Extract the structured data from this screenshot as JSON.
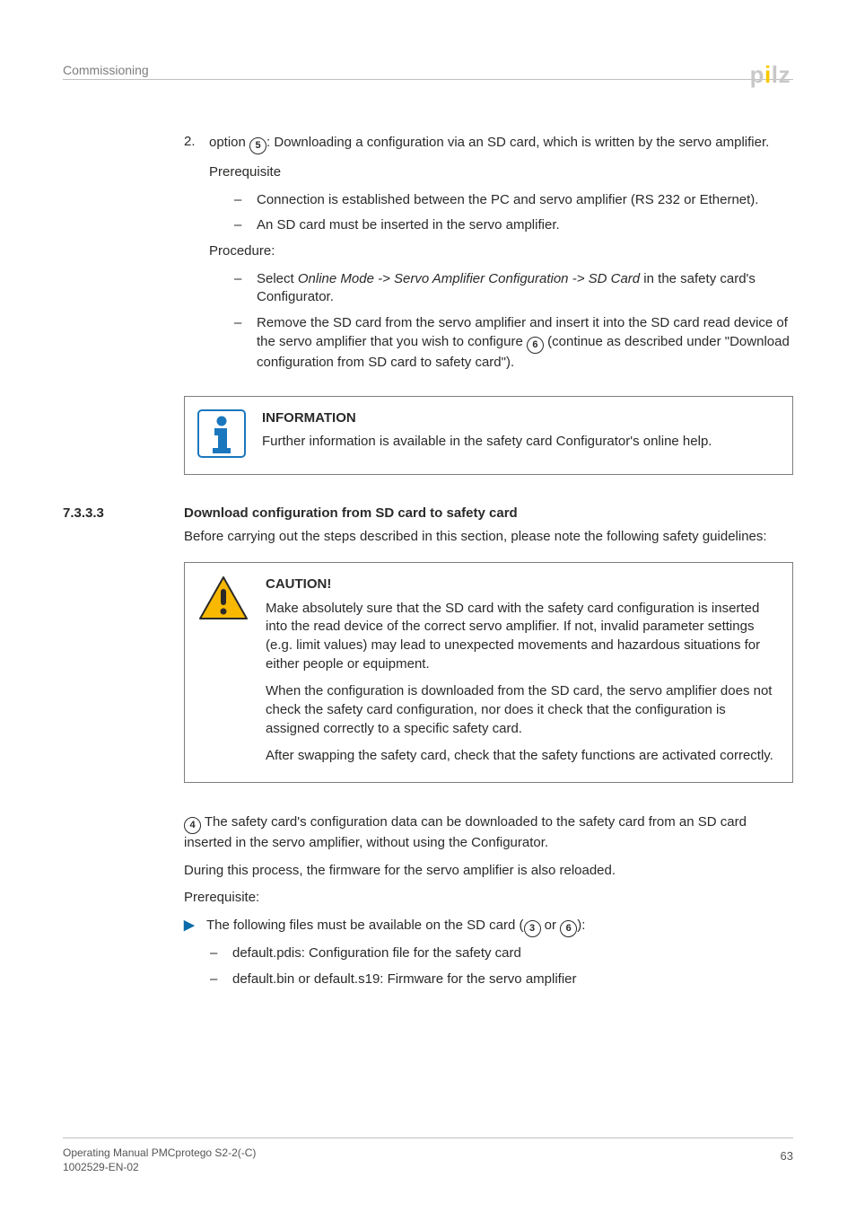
{
  "runningHead": "Commissioning",
  "logo": {
    "pre": "p",
    "dot": "i",
    "post": "lz"
  },
  "step2": {
    "num": "2.",
    "lead_a": "option ",
    "circ": "5",
    "lead_b": ": Downloading a configuration via an SD card, which is written by the servo amplifier.",
    "prereqLabel": "Prerequisite",
    "prereq1": "Connection is established between the PC and servo amplifier (RS 232 or Ethernet).",
    "prereq2": "An SD card must be inserted in the servo amplifier.",
    "procLabel": "Procedure:",
    "proc1_a": "Select ",
    "proc1_i": "Online Mode -> Servo Amplifier Configuration -> SD Card",
    "proc1_b": " in the safety card's Configurator.",
    "proc2_a": "Remove the SD card from the servo amplifier and insert it into the SD card read device of the servo amplifier that you wish to configure ",
    "proc2_circ": "6",
    "proc2_b": " (continue as described under \"Download configuration from SD card to safety card\")."
  },
  "infoBox": {
    "title": "INFORMATION",
    "body": "Further information is available in the safety card Configurator's online help."
  },
  "section": {
    "num": "7.3.3.3",
    "title": "Download configuration from SD card to safety card",
    "intro": "Before carrying out the steps described in this section, please note the following safety guidelines:"
  },
  "cautionBox": {
    "title": "CAUTION!",
    "p1": "Make absolutely sure that the SD card with the safety card configuration is inserted into the read device of the correct servo amplifier. If not, invalid parameter settings (e.g. limit values) may lead to unexpected movements and hazardous situations for either people or equipment.",
    "p2": "When the configuration is downloaded from the SD card, the servo amplifier does not check the safety card configuration, nor does it check that the configuration is assigned correctly to a specific safety card.",
    "p3": "After swapping the safety card, check that the safety functions are activated correctly."
  },
  "afterBox": {
    "circ": "4",
    "p1": " The safety card's configuration data can be downloaded to the safety card from an SD card inserted in the servo amplifier, without using the Configurator.",
    "p2": "During this process, the firmware for the servo amplifier is also reloaded.",
    "p3": "Prerequisite:",
    "tri_a": "The following files must be available on the SD card (",
    "tri_c1": "3",
    "tri_or": " or ",
    "tri_c2": "6",
    "tri_b": "):",
    "d1": "default.pdis: Configuration file for the safety card",
    "d2": "default.bin or default.s19: Firmware for the servo amplifier"
  },
  "footer": {
    "left1": "Operating Manual PMCprotego S2-2(-C)",
    "left2": "1002529-EN-02",
    "page": "63"
  }
}
